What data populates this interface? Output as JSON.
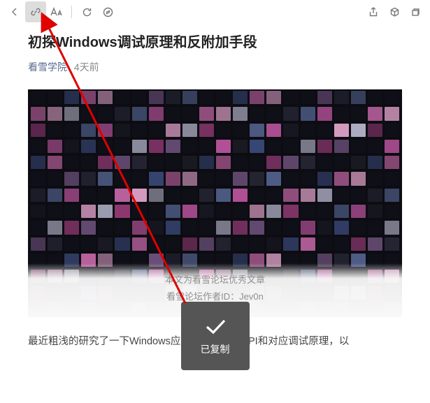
{
  "toolbar": {
    "back": "返回",
    "link": "复制链接",
    "font": "字体",
    "refresh": "刷新",
    "compass": "浏览器打开",
    "share": "分享",
    "cube": "更多",
    "popout": "新窗口"
  },
  "article": {
    "title": "初探Windows调试原理和反附加手段",
    "author": "看雪学院",
    "date": "4天前",
    "overlay_line1": "本文为看雪论坛优秀文章",
    "overlay_line2": "看雪论坛作者ID：Jev0n",
    "body_p1": "最近粗浅的研究了一下Windows应用层相关调试API和对应调试原理，以"
  },
  "toast": {
    "text": "已复制"
  },
  "arrow": {
    "color": "#e00000"
  }
}
